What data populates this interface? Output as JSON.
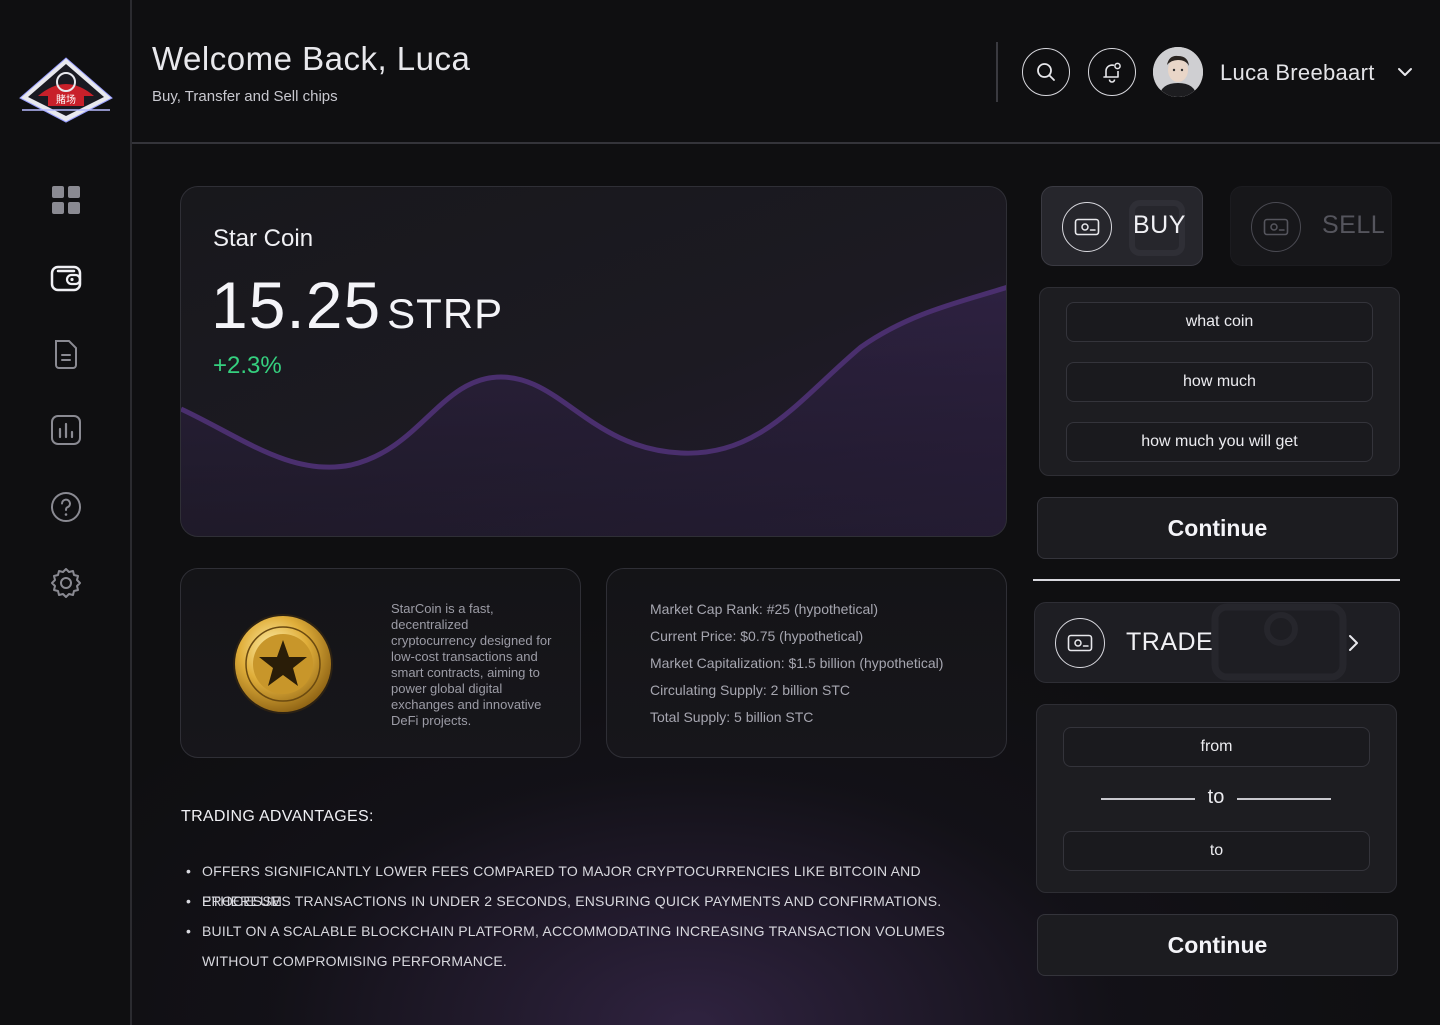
{
  "header": {
    "welcome": "Welcome Back, Luca",
    "subtitle": "Buy, Transfer and Sell chips",
    "user_name": "Luca Breebaart"
  },
  "sidebar": {
    "items": [
      {
        "name": "dashboard",
        "icon": "grid-icon"
      },
      {
        "name": "wallet",
        "icon": "wallet-icon",
        "active": true
      },
      {
        "name": "documents",
        "icon": "document-icon"
      },
      {
        "name": "analytics",
        "icon": "bar-chart-icon"
      },
      {
        "name": "help",
        "icon": "help-icon"
      },
      {
        "name": "settings",
        "icon": "gear-icon"
      }
    ]
  },
  "coin": {
    "name": "Star Coin",
    "price": "15.25",
    "unit": "STRP",
    "change": "+2.3%",
    "description": "StarCoin is a fast, decentralized cryptocurrency designed for low-cost transactions and smart contracts, aiming to power global digital exchanges and innovative DeFi projects."
  },
  "stats": [
    "Market Cap Rank: #25 (hypothetical)",
    "Current Price: $0.75 (hypothetical)",
    "Market Capitalization: $1.5 billion (hypothetical)",
    "Circulating Supply: 2 billion STC",
    "Total Supply: 5 billion STC"
  ],
  "advantages": {
    "title": "TRADING ADVANTAGES:",
    "items": [
      "OFFERS SIGNIFICANTLY LOWER FEES COMPARED TO MAJOR CRYPTOCURRENCIES LIKE BITCOIN AND ETHEREUM.",
      "PROCESSES TRANSACTIONS IN UNDER 2 SECONDS, ENSURING QUICK PAYMENTS AND CONFIRMATIONS.",
      "BUILT ON A SCALABLE BLOCKCHAIN PLATFORM, ACCOMMODATING INCREASING TRANSACTION VOLUMES WITHOUT COMPROMISING PERFORMANCE."
    ]
  },
  "buy_sell": {
    "buy_label": "BUY",
    "sell_label": "SELL",
    "fields": [
      "what coin",
      "how much",
      "how much you will get"
    ],
    "continue_label": "Continue"
  },
  "trade": {
    "label": "TRADE",
    "from": "from",
    "separator": "to",
    "to": "to",
    "continue_label": "Continue"
  },
  "colors": {
    "accent_green": "#35d07f",
    "chart_purple": "#4a2f6e",
    "background": "#0f0f11"
  }
}
